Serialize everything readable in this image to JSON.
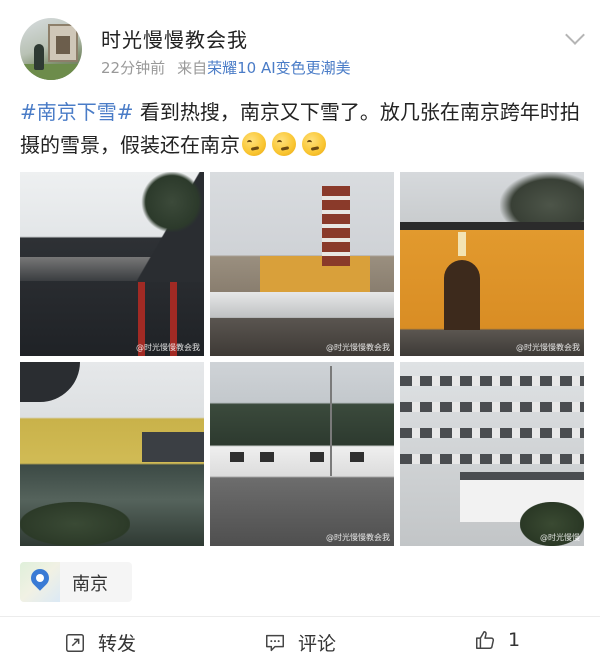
{
  "post": {
    "username": "时光慢慢教会我",
    "time": "22分钟前",
    "source_prefix": "来自",
    "device": "荣耀10 AI变色更潮美",
    "hashtag": "#南京下雪#",
    "text": "看到热搜，南京又下雪了。放几张在南京跨年时拍摄的雪景，假装还在南京",
    "emoji_count": 3,
    "photos": [
      {
        "watermark": "@时光慢慢教会我"
      },
      {
        "watermark": "@时光慢慢教会我"
      },
      {
        "watermark": "@时光慢慢教会我"
      },
      {
        "watermark": ""
      },
      {
        "watermark": "@时光慢慢教会我"
      },
      {
        "watermark": "@时光慢慢"
      }
    ],
    "location": "南京"
  },
  "actions": {
    "forward_label": "转发",
    "comment_label": "评论",
    "like_count": "1"
  },
  "icons": {
    "location": "location-pin-icon",
    "forward": "forward-share-icon",
    "comment": "comment-icon",
    "like": "thumbs-up-icon",
    "more": "chevron-down-icon"
  },
  "colors": {
    "link": "#4a7cc7",
    "meta": "#999999",
    "text": "#222222"
  }
}
